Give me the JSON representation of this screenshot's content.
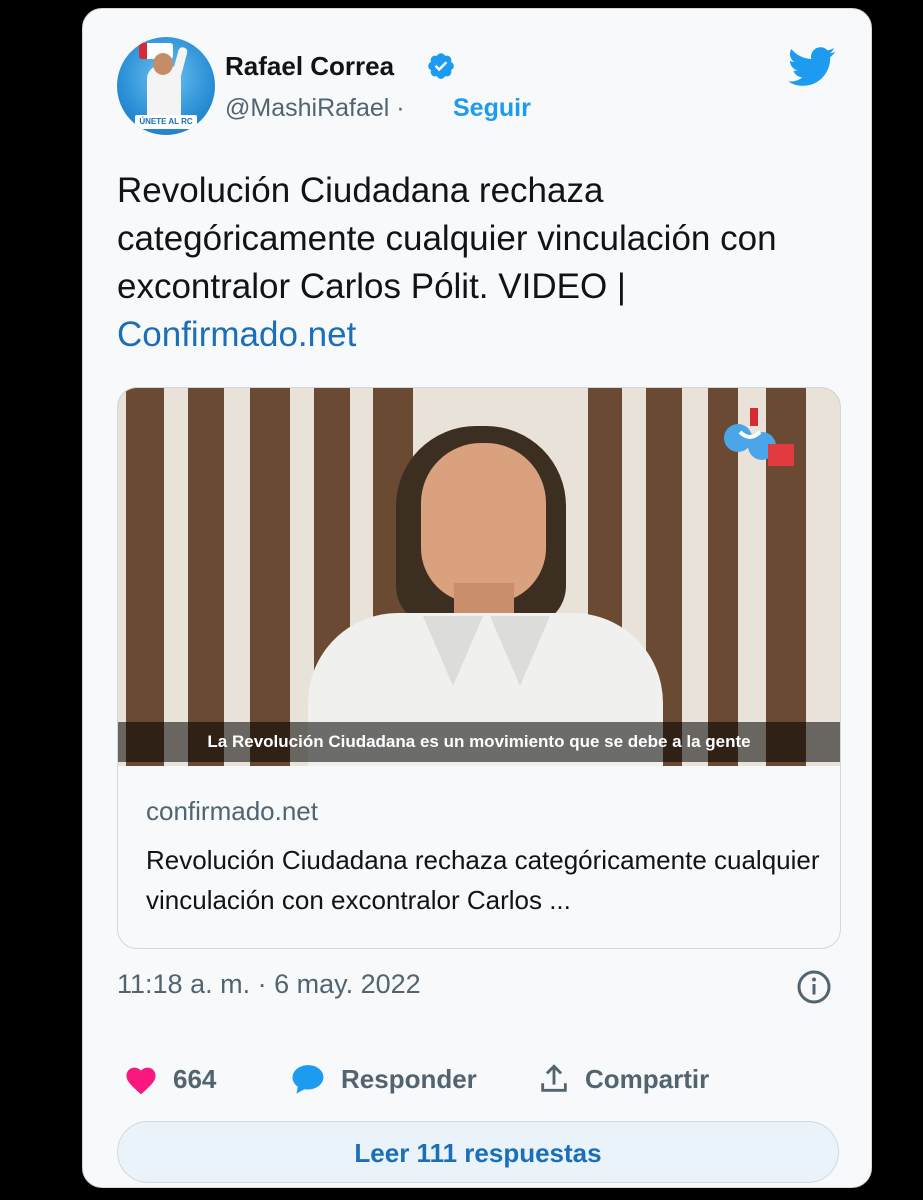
{
  "tweet": {
    "author_name": "Rafael Correa",
    "handle": "@MashiRafael",
    "separator": "·",
    "follow_label": "Seguir",
    "avatar_tag": "ÚNETE AL RC",
    "text": "Revolución Ciudadana rechaza categóricamente cualquier vinculación con excontralor Carlos Pólit. VIDEO |",
    "link_text": "Confirmado.net",
    "timestamp": "11:18 a. m. · 6 may. 2022"
  },
  "link_card": {
    "video_subtitle": "La Revolución Ciudadana es un movimiento que se debe a la gente",
    "domain": "confirmado.net",
    "title": "Revolución Ciudadana rechaza categóricamente cualquier vinculación con excontralor Carlos ..."
  },
  "actions": {
    "likes": "664",
    "reply_label": "Responder",
    "share_label": "Compartir"
  },
  "read_replies_label": "Leer 111 respuestas",
  "icons": [
    "verified-badge-icon",
    "twitter-bird-icon",
    "info-icon",
    "heart-icon",
    "reply-bubble-icon",
    "share-icon"
  ],
  "colors": {
    "accent": "#1d9bf0",
    "heart": "#f91880",
    "text": "#0f1419",
    "muted": "#536471"
  }
}
